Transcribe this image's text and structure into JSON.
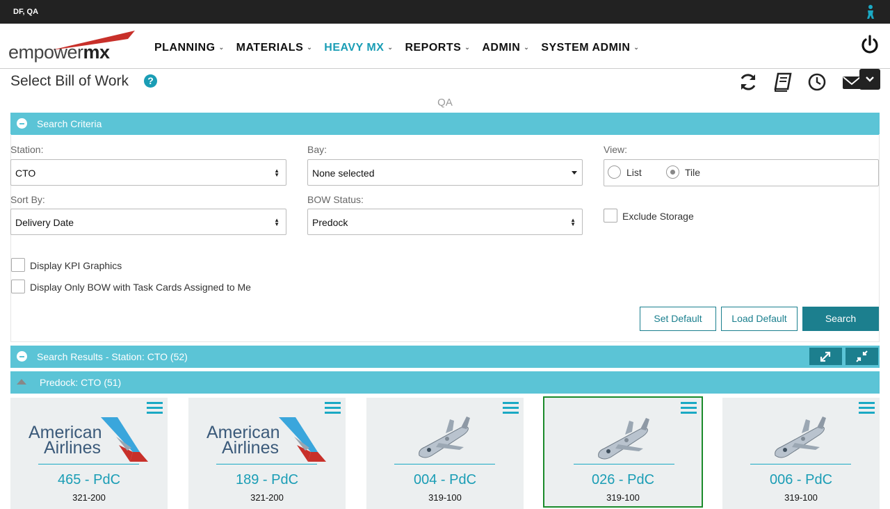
{
  "topbar": {
    "user": "DF, QA"
  },
  "nav": {
    "logo_text_a": "empower",
    "logo_text_b": "mx",
    "items": [
      {
        "label": "PLANNING"
      },
      {
        "label": "MATERIALS"
      },
      {
        "label": "HEAVY MX"
      },
      {
        "label": "REPORTS"
      },
      {
        "label": "ADMIN"
      },
      {
        "label": "SYSTEM ADMIN"
      }
    ],
    "active_index": 2,
    "caret": "⌄"
  },
  "page": {
    "title": "Select Bill of Work",
    "help_glyph": "?",
    "environment": "QA"
  },
  "criteria": {
    "header": "Search Criteria",
    "station_label": "Station:",
    "station_value": "CTO",
    "bay_label": "Bay:",
    "bay_value": "None selected",
    "view_label": "View:",
    "view_options": [
      "List",
      "Tile"
    ],
    "view_selected": "Tile",
    "sortby_label": "Sort By:",
    "sortby_value": "Delivery Date",
    "bow_status_label": "BOW Status:",
    "bow_status_value": "Predock",
    "exclude_storage": "Exclude Storage",
    "display_kpi": "Display KPI Graphics",
    "display_only_mine": "Display Only BOW with Task Cards Assigned to Me",
    "set_default": "Set Default",
    "load_default": "Load Default",
    "search": "Search"
  },
  "results": {
    "header": "Search Results - Station: CTO (52)",
    "group": "Predock: CTO (51)",
    "tiles": [
      {
        "name": "465 - PdC",
        "type": "321-200",
        "logo": "american-airlines",
        "selected": false
      },
      {
        "name": "189 - PdC",
        "type": "321-200",
        "logo": "american-airlines",
        "selected": false
      },
      {
        "name": "004 - PdC",
        "type": "319-100",
        "logo": "jet",
        "selected": false
      },
      {
        "name": "026 - PdC",
        "type": "319-100",
        "logo": "jet",
        "selected": true
      },
      {
        "name": "006 - PdC",
        "type": "319-100",
        "logo": "jet",
        "selected": false
      }
    ],
    "aa_line1": "American",
    "aa_line2": "Airlines"
  },
  "colors": {
    "accent": "#5bc4d6",
    "active_nav": "#1a9db5",
    "primary_button": "#1c7f8e",
    "selected_tile_border": "#1a8a2a"
  },
  "icons": [
    "person-icon",
    "power-icon",
    "refresh-icon",
    "book-icon",
    "clock-icon",
    "envelope-icon",
    "chevron-down-icon",
    "expand-icon",
    "compress-icon",
    "menu-icon"
  ]
}
